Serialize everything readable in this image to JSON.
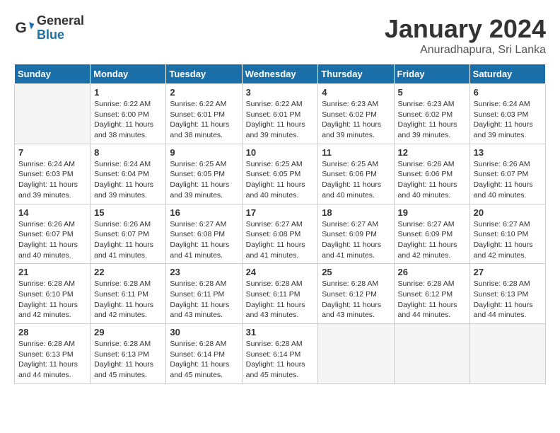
{
  "logo": {
    "general": "General",
    "blue": "Blue"
  },
  "title": "January 2024",
  "subtitle": "Anuradhapura, Sri Lanka",
  "days_header": [
    "Sunday",
    "Monday",
    "Tuesday",
    "Wednesday",
    "Thursday",
    "Friday",
    "Saturday"
  ],
  "weeks": [
    [
      {
        "day": "",
        "info": ""
      },
      {
        "day": "1",
        "info": "Sunrise: 6:22 AM\nSunset: 6:00 PM\nDaylight: 11 hours\nand 38 minutes."
      },
      {
        "day": "2",
        "info": "Sunrise: 6:22 AM\nSunset: 6:01 PM\nDaylight: 11 hours\nand 38 minutes."
      },
      {
        "day": "3",
        "info": "Sunrise: 6:22 AM\nSunset: 6:01 PM\nDaylight: 11 hours\nand 39 minutes."
      },
      {
        "day": "4",
        "info": "Sunrise: 6:23 AM\nSunset: 6:02 PM\nDaylight: 11 hours\nand 39 minutes."
      },
      {
        "day": "5",
        "info": "Sunrise: 6:23 AM\nSunset: 6:02 PM\nDaylight: 11 hours\nand 39 minutes."
      },
      {
        "day": "6",
        "info": "Sunrise: 6:24 AM\nSunset: 6:03 PM\nDaylight: 11 hours\nand 39 minutes."
      }
    ],
    [
      {
        "day": "7",
        "info": "Sunrise: 6:24 AM\nSunset: 6:03 PM\nDaylight: 11 hours\nand 39 minutes."
      },
      {
        "day": "8",
        "info": "Sunrise: 6:24 AM\nSunset: 6:04 PM\nDaylight: 11 hours\nand 39 minutes."
      },
      {
        "day": "9",
        "info": "Sunrise: 6:25 AM\nSunset: 6:05 PM\nDaylight: 11 hours\nand 39 minutes."
      },
      {
        "day": "10",
        "info": "Sunrise: 6:25 AM\nSunset: 6:05 PM\nDaylight: 11 hours\nand 40 minutes."
      },
      {
        "day": "11",
        "info": "Sunrise: 6:25 AM\nSunset: 6:06 PM\nDaylight: 11 hours\nand 40 minutes."
      },
      {
        "day": "12",
        "info": "Sunrise: 6:26 AM\nSunset: 6:06 PM\nDaylight: 11 hours\nand 40 minutes."
      },
      {
        "day": "13",
        "info": "Sunrise: 6:26 AM\nSunset: 6:07 PM\nDaylight: 11 hours\nand 40 minutes."
      }
    ],
    [
      {
        "day": "14",
        "info": "Sunrise: 6:26 AM\nSunset: 6:07 PM\nDaylight: 11 hours\nand 40 minutes."
      },
      {
        "day": "15",
        "info": "Sunrise: 6:26 AM\nSunset: 6:07 PM\nDaylight: 11 hours\nand 41 minutes."
      },
      {
        "day": "16",
        "info": "Sunrise: 6:27 AM\nSunset: 6:08 PM\nDaylight: 11 hours\nand 41 minutes."
      },
      {
        "day": "17",
        "info": "Sunrise: 6:27 AM\nSunset: 6:08 PM\nDaylight: 11 hours\nand 41 minutes."
      },
      {
        "day": "18",
        "info": "Sunrise: 6:27 AM\nSunset: 6:09 PM\nDaylight: 11 hours\nand 41 minutes."
      },
      {
        "day": "19",
        "info": "Sunrise: 6:27 AM\nSunset: 6:09 PM\nDaylight: 11 hours\nand 42 minutes."
      },
      {
        "day": "20",
        "info": "Sunrise: 6:27 AM\nSunset: 6:10 PM\nDaylight: 11 hours\nand 42 minutes."
      }
    ],
    [
      {
        "day": "21",
        "info": "Sunrise: 6:28 AM\nSunset: 6:10 PM\nDaylight: 11 hours\nand 42 minutes."
      },
      {
        "day": "22",
        "info": "Sunrise: 6:28 AM\nSunset: 6:11 PM\nDaylight: 11 hours\nand 42 minutes."
      },
      {
        "day": "23",
        "info": "Sunrise: 6:28 AM\nSunset: 6:11 PM\nDaylight: 11 hours\nand 43 minutes."
      },
      {
        "day": "24",
        "info": "Sunrise: 6:28 AM\nSunset: 6:11 PM\nDaylight: 11 hours\nand 43 minutes."
      },
      {
        "day": "25",
        "info": "Sunrise: 6:28 AM\nSunset: 6:12 PM\nDaylight: 11 hours\nand 43 minutes."
      },
      {
        "day": "26",
        "info": "Sunrise: 6:28 AM\nSunset: 6:12 PM\nDaylight: 11 hours\nand 44 minutes."
      },
      {
        "day": "27",
        "info": "Sunrise: 6:28 AM\nSunset: 6:13 PM\nDaylight: 11 hours\nand 44 minutes."
      }
    ],
    [
      {
        "day": "28",
        "info": "Sunrise: 6:28 AM\nSunset: 6:13 PM\nDaylight: 11 hours\nand 44 minutes."
      },
      {
        "day": "29",
        "info": "Sunrise: 6:28 AM\nSunset: 6:13 PM\nDaylight: 11 hours\nand 45 minutes."
      },
      {
        "day": "30",
        "info": "Sunrise: 6:28 AM\nSunset: 6:14 PM\nDaylight: 11 hours\nand 45 minutes."
      },
      {
        "day": "31",
        "info": "Sunrise: 6:28 AM\nSunset: 6:14 PM\nDaylight: 11 hours\nand 45 minutes."
      },
      {
        "day": "",
        "info": ""
      },
      {
        "day": "",
        "info": ""
      },
      {
        "day": "",
        "info": ""
      }
    ]
  ]
}
